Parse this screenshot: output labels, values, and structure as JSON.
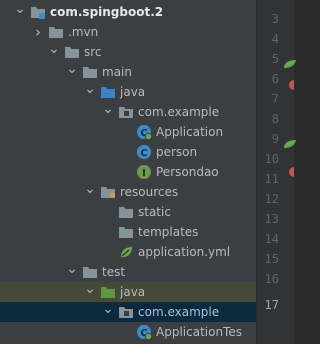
{
  "tree": [
    {
      "key": "project",
      "label": "com.spingboot.2",
      "bold": true,
      "arrow": "down",
      "icon": "module-folder-icon"
    },
    {
      "key": "mvn",
      "label": ".mvn",
      "arrow": "right",
      "icon": "folder-icon"
    },
    {
      "key": "src",
      "label": "src",
      "arrow": "down",
      "icon": "folder-icon"
    },
    {
      "key": "main",
      "label": "main",
      "arrow": "down",
      "icon": "folder-icon"
    },
    {
      "key": "java-main",
      "label": "java",
      "arrow": "down",
      "icon": "source-folder-icon"
    },
    {
      "key": "package-main",
      "label": "com.example",
      "arrow": "down",
      "icon": "package-icon"
    },
    {
      "key": "application-class",
      "label": "Application",
      "icon": "spring-class-icon"
    },
    {
      "key": "person-class",
      "label": "person",
      "icon": "class-icon"
    },
    {
      "key": "persondao-interface",
      "label": "Persondao",
      "icon": "interface-icon"
    },
    {
      "key": "resources",
      "label": "resources",
      "arrow": "down",
      "icon": "resources-folder-icon"
    },
    {
      "key": "static",
      "label": "static",
      "icon": "folder-icon"
    },
    {
      "key": "templates",
      "label": "templates",
      "icon": "folder-icon"
    },
    {
      "key": "application-yml",
      "label": "application.yml",
      "icon": "yml-file-icon"
    },
    {
      "key": "test",
      "label": "test",
      "arrow": "down",
      "icon": "folder-icon"
    },
    {
      "key": "java-test",
      "label": "java",
      "arrow": "down",
      "icon": "test-folder-icon"
    },
    {
      "key": "package-test",
      "label": "com.example",
      "arrow": "down",
      "icon": "package-icon"
    },
    {
      "key": "applicationtests-class",
      "label": "ApplicationTes",
      "icon": "spring-class-icon"
    }
  ],
  "gutter": {
    "line_numbers": [
      "3",
      "4",
      "5",
      "6",
      "7",
      "8",
      "9",
      "10",
      "11",
      "12",
      "13",
      "14",
      "15",
      "16",
      "17"
    ],
    "current_line": "17"
  },
  "colors": {
    "tree_bg": "#3c3f41",
    "selection_dark": "#0d293e",
    "selection_light": "#434a3a",
    "class_icon": "#3d8cc7",
    "interface_icon": "#6b9a4b",
    "spring_green": "#6aa84f"
  }
}
